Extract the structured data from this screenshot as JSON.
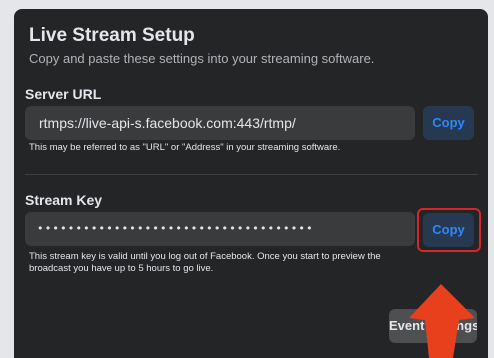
{
  "header": {
    "title": "Live Stream Setup",
    "subtitle": "Copy and paste these settings into your streaming software."
  },
  "server": {
    "label": "Server URL",
    "value": "rtmps://live-api-s.facebook.com:443/rtmp/",
    "copy_label": "Copy",
    "hint": "This may be referred to as \"URL\" or \"Address\" in your streaming software."
  },
  "stream_key": {
    "label": "Stream Key",
    "masked_value": "••••••••••••••••••••••••••••••••••••",
    "copy_label": "Copy",
    "hint_line1": "This stream key is valid until you log out of Facebook. Once you start to preview the",
    "hint_line2": "broadcast you have up to 5 hours to go live."
  },
  "footer": {
    "event_settings_label": "Event Settings"
  },
  "colors": {
    "panel": "#242526",
    "accent": "#2d88ff",
    "highlight": "#d9252a",
    "arrow": "#e8401c"
  }
}
